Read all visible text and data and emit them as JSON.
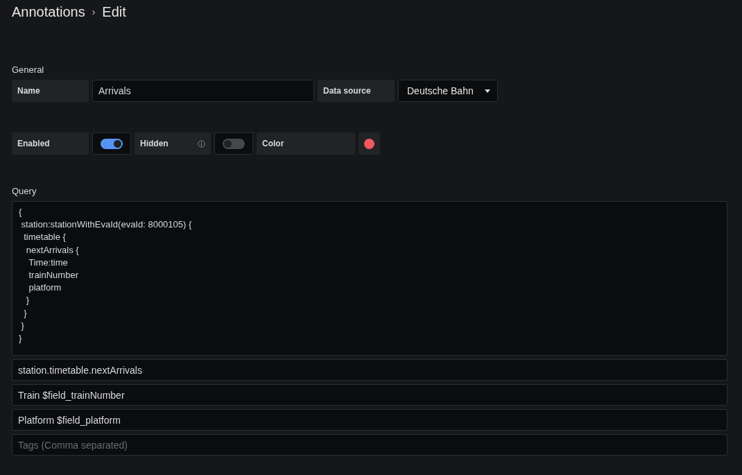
{
  "breadcrumb": {
    "parent": "Annotations",
    "separator": "›",
    "current": "Edit"
  },
  "general": {
    "heading": "General",
    "name_label": "Name",
    "name_value": "Arrivals",
    "datasource_label": "Data source",
    "datasource_value": "Deutsche Bahn"
  },
  "toggles": [
    {
      "kind": "switch",
      "label": "Enabled",
      "on": true,
      "info": false
    },
    {
      "kind": "switch",
      "label": "Hidden",
      "on": false,
      "info": true
    },
    {
      "kind": "color",
      "label": "Color",
      "color": "#f2595a"
    }
  ],
  "query": {
    "heading": "Query",
    "text": "{\n station:stationWithEvaId(evaId: 8000105) {\n  timetable {\n   nextArrivals {\n    Time:time\n    trainNumber\n    platform\n   }\n  }\n }\n}"
  },
  "fields": [
    {
      "value": "station.timetable.nextArrivals"
    },
    {
      "value": "Train $field_trainNumber"
    },
    {
      "value": "Platform $field_platform"
    },
    {
      "placeholder": "Tags (Comma separated)"
    }
  ]
}
